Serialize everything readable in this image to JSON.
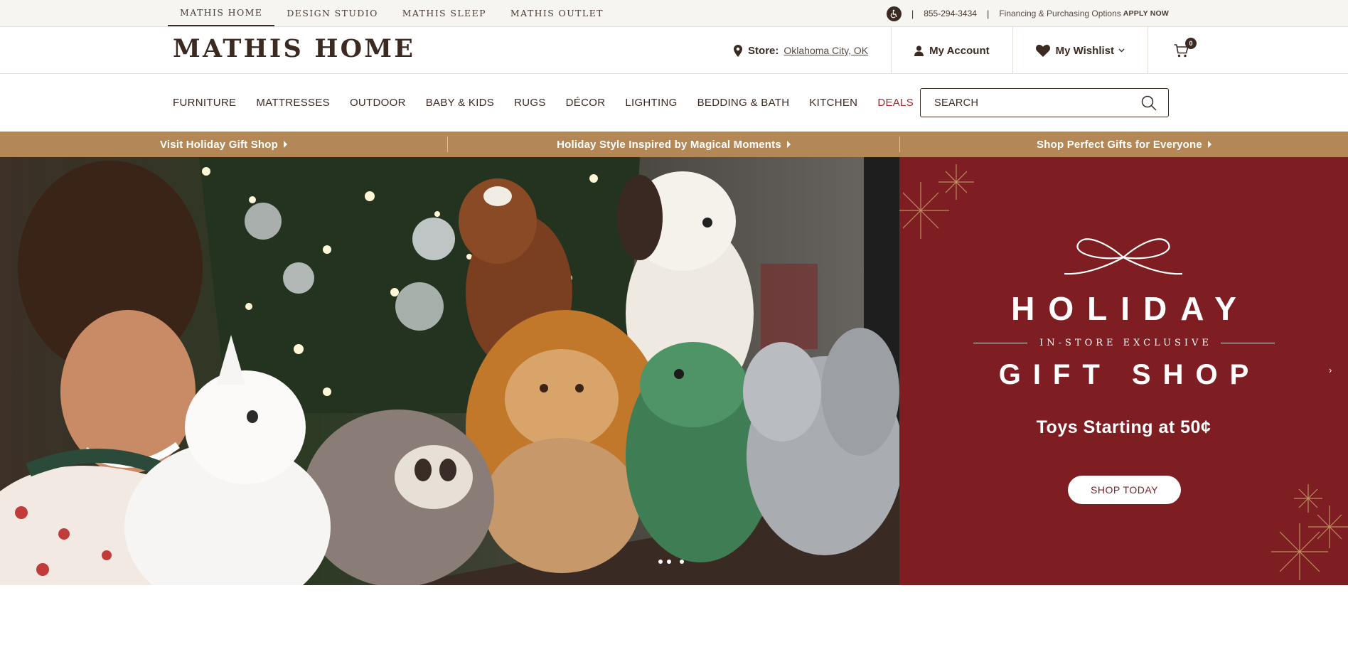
{
  "utility": {
    "brand_tabs": [
      {
        "label": "MATHIS HOME",
        "active": true
      },
      {
        "label": "DESIGN STUDIO",
        "active": false
      },
      {
        "label": "MATHIS SLEEP",
        "active": false
      },
      {
        "label": "MATHIS OUTLET",
        "active": false
      }
    ],
    "accessibility_icon": "accessibility-icon",
    "phone": "855-294-3434",
    "financing_text": "Financing & Purchasing Options",
    "apply_now": "APPLY NOW"
  },
  "header": {
    "logo": "MATHIS HOME",
    "store_label": "Store:",
    "store_value": "Oklahoma City, OK",
    "account_label": "My Account",
    "wishlist_label": "My Wishlist",
    "cart_count": "0"
  },
  "nav": {
    "items": [
      "FURNITURE",
      "MATTRESSES",
      "OUTDOOR",
      "BABY & KIDS",
      "RUGS",
      "DÉCOR",
      "LIGHTING",
      "BEDDING & BATH",
      "KITCHEN",
      "DEALS"
    ],
    "search_placeholder": "SEARCH"
  },
  "promo": {
    "items": [
      "Visit Holiday Gift Shop",
      "Holiday Style Inspired by Magical Moments",
      "Shop Perfect Gifts for Everyone"
    ]
  },
  "hero": {
    "title_top": "HOLIDAY",
    "subtitle": "IN-STORE EXCLUSIVE",
    "title_bottom": "GIFT SHOP",
    "tagline": "Toys Starting at 50¢",
    "cta": "SHOP TODAY",
    "slide_count": 3,
    "active_slide": 1
  },
  "colors": {
    "brand_brown": "#3b2a22",
    "promo_gold": "#b38856",
    "hero_red": "#7e1d22",
    "deals_red": "#a3282a"
  }
}
